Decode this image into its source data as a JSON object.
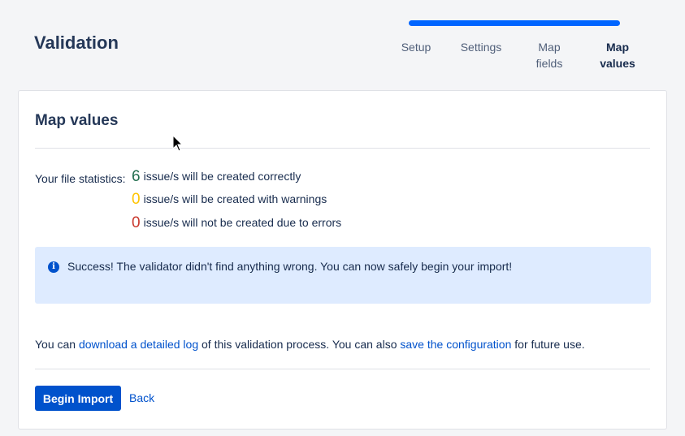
{
  "page": {
    "title": "Validation"
  },
  "tracker": {
    "accent": "#0065ff",
    "steps": [
      {
        "lines": [
          "Setup"
        ],
        "current": false
      },
      {
        "lines": [
          "Settings"
        ],
        "current": false
      },
      {
        "lines": [
          "Map",
          "fields"
        ],
        "current": false
      },
      {
        "lines": [
          "Map",
          "values"
        ],
        "current": true
      }
    ]
  },
  "card": {
    "title": "Map values",
    "stats": {
      "label": "Your file statistics:",
      "rows": [
        {
          "count": "6",
          "text": "issue/s will be created correctly",
          "color": "#216e4e"
        },
        {
          "count": "0",
          "text": "issue/s will be created with warnings",
          "color": "#ffc400"
        },
        {
          "count": "0",
          "text": "issue/s will not be created due to errors",
          "color": "#c9372c"
        }
      ]
    },
    "info": {
      "icon": "info-icon",
      "message": "Success! The validator didn't find anything wrong. You can now safely begin your import!"
    },
    "log": {
      "prefix": "You can ",
      "download_link": "download a detailed log",
      "middle": " of this validation process. You can also ",
      "config_link": "save the configuration",
      "suffix": " for future use."
    },
    "actions": {
      "begin_label": "Begin Import",
      "back_label": "Back"
    }
  }
}
